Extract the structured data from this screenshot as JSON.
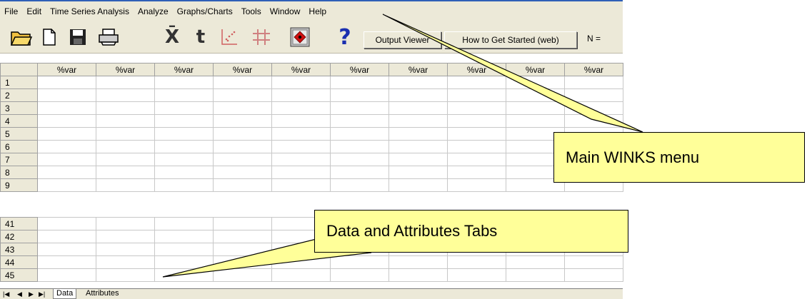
{
  "menu": [
    "File",
    "Edit",
    "Time Series Analysis",
    "Analyze",
    "Graphs/Charts",
    "Tools",
    "Window",
    "Help"
  ],
  "toolbar": {
    "xbar_label": "X̄",
    "t_label": "t",
    "help_label": "?",
    "output_viewer": "Output Viewer",
    "get_started": "How to Get Started (web)",
    "n_label": "N ="
  },
  "grid": {
    "column_header": "%var",
    "rows_top": [
      "1",
      "2",
      "3",
      "4",
      "5",
      "6",
      "7",
      "8",
      "9"
    ],
    "rows_bottom": [
      "41",
      "42",
      "43",
      "44",
      "45"
    ]
  },
  "tabs": {
    "data": "Data",
    "attributes": "Attributes"
  },
  "callouts": {
    "menu": "Main WINKS menu",
    "tabs": "Data and Attributes Tabs"
  },
  "colors": {
    "callout_fill": "#ffff99",
    "menubar_bg": "#ece9d8"
  }
}
